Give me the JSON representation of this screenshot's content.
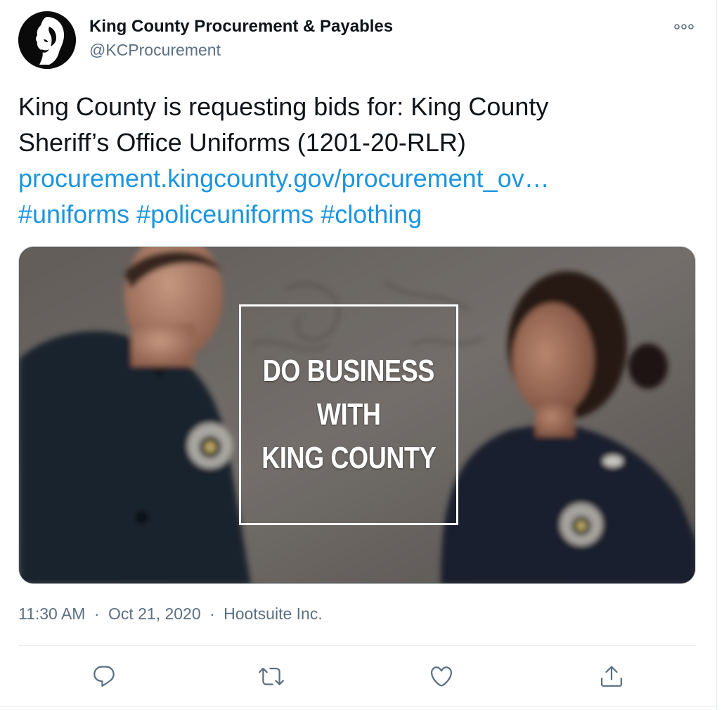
{
  "tweet": {
    "author": {
      "display_name": "King County Procurement & Payables",
      "handle": "@KCProcurement",
      "avatar_icon": "king-county-logo-icon"
    },
    "more_icon": "more-options-icon",
    "text_lines": [
      "King County is requesting bids for: King County",
      "Sheriff’s Office Uniforms (1201-20-RLR)"
    ],
    "link": "procurement.kingcounty.gov/procurement_ov…",
    "hashtags": [
      "#uniforms",
      "#policeuniforms",
      "#clothing"
    ],
    "media": {
      "overlay_lines": [
        "DO BUSINESS",
        "WITH",
        "KING COUNTY"
      ]
    },
    "meta": {
      "time": "11:30 AM",
      "date": "Oct 21, 2020",
      "source": "Hootsuite Inc.",
      "separator": "·"
    },
    "actions": [
      {
        "name": "reply",
        "icon": "reply-icon"
      },
      {
        "name": "retweet",
        "icon": "retweet-icon"
      },
      {
        "name": "like",
        "icon": "heart-icon"
      },
      {
        "name": "share",
        "icon": "share-icon"
      }
    ]
  },
  "colors": {
    "link": "#1b95e0",
    "secondary_text": "#5b7083",
    "primary_text": "#0f1419",
    "divider": "#e6ecf0"
  }
}
